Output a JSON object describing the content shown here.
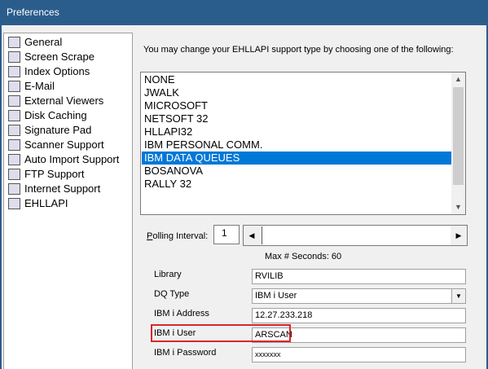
{
  "window": {
    "title": "Preferences"
  },
  "sidebar": {
    "items": [
      {
        "label": "General",
        "icon": "general-icon"
      },
      {
        "label": "Screen Scrape",
        "icon": "screen-scrape-icon"
      },
      {
        "label": "Index Options",
        "icon": "index-options-icon"
      },
      {
        "label": "E-Mail",
        "icon": "email-icon"
      },
      {
        "label": "External Viewers",
        "icon": "external-viewers-icon"
      },
      {
        "label": "Disk Caching",
        "icon": "disk-caching-icon"
      },
      {
        "label": "Signature Pad",
        "icon": "signature-pad-icon"
      },
      {
        "label": "Scanner Support",
        "icon": "scanner-icon"
      },
      {
        "label": "Auto Import Support",
        "icon": "auto-import-icon"
      },
      {
        "label": "FTP Support",
        "icon": "ftp-icon"
      },
      {
        "label": "Internet Support",
        "icon": "internet-icon"
      },
      {
        "label": "EHLLAPI",
        "icon": "ehllapi-icon"
      }
    ],
    "selected": "EHLLAPI"
  },
  "ehllapi": {
    "intro": "You may change your EHLLAPI support type by choosing one of the following:",
    "types": [
      "NONE",
      "JWALK",
      "MICROSOFT",
      "NETSOFT 32",
      "HLLAPI32",
      "IBM PERSONAL COMM.",
      "IBM DATA QUEUES",
      "BOSANOVA",
      "RALLY 32"
    ],
    "selected_type": "IBM DATA QUEUES",
    "polling_label_prefix": "P",
    "polling_label_rest": "olling Interval:",
    "polling_value": "1",
    "max_seconds": "Max # Seconds: 60"
  },
  "fields": {
    "library_label": "Library",
    "library_value": "RVILIB",
    "dqtype_label": "DQ Type",
    "dqtype_value": "IBM i User",
    "address_label": "IBM i Address",
    "address_value": "12.27.233.218",
    "user_label": "IBM i User",
    "user_value": "ARSCAN",
    "password_label": "IBM i Password",
    "password_value": "xxxxxxx"
  },
  "colors": {
    "titlebar": "#2b5d8c",
    "selection": "#0078d7",
    "highlight": "#d9262b"
  }
}
